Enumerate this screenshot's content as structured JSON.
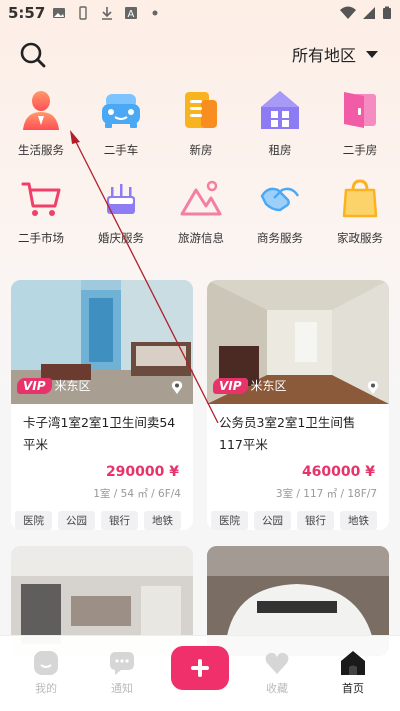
{
  "status_bar": {
    "time": "5:57"
  },
  "header": {
    "region_label": "所有地区",
    "icons": {
      "search": "search-icon",
      "dropdown": "caret-down-icon"
    }
  },
  "categories": [
    {
      "label": "生活服务",
      "icon": "person-service-icon",
      "color": "#ff6a55"
    },
    {
      "label": "二手车",
      "icon": "car-icon",
      "color": "#4aa8f5"
    },
    {
      "label": "新房",
      "icon": "building-icon",
      "color": "#f9a824"
    },
    {
      "label": "租房",
      "icon": "house-icon",
      "color": "#8c7bf2"
    },
    {
      "label": "二手房",
      "icon": "door-icon",
      "color": "#f25ba5"
    },
    {
      "label": "二手市场",
      "icon": "cart-icon",
      "color": "#f0406a"
    },
    {
      "label": "婚庆服务",
      "icon": "cake-icon",
      "color": "#8d7cf2"
    },
    {
      "label": "旅游信息",
      "icon": "mountain-icon",
      "color": "#f37fa3"
    },
    {
      "label": "商务服务",
      "icon": "handshake-icon",
      "color": "#4aa8f5"
    },
    {
      "label": "家政服务",
      "icon": "bag-icon",
      "color": "#f9b320"
    }
  ],
  "listings": [
    {
      "badge": "VIP",
      "district": "米东区",
      "title": "卡子湾1室2室1卫生间卖54平米",
      "price": "290000 ¥",
      "meta": "1室 / 54 ㎡ / 6F/4",
      "tags": [
        "",
        "医院",
        "公园",
        "银行",
        "地铁"
      ]
    },
    {
      "badge": "VIP",
      "district": "米东区",
      "title": "公务员3室2室1卫生间售117平米",
      "price": "460000 ¥",
      "meta": "3室 / 117 ㎡ / 18F/7",
      "tags": [
        "",
        "医院",
        "公园",
        "银行",
        "地铁"
      ]
    }
  ],
  "tabbar": {
    "tabs": [
      {
        "label": "我的",
        "icon": "profile-icon"
      },
      {
        "label": "通知",
        "icon": "message-icon"
      },
      {
        "label": "",
        "icon": "plus-icon"
      },
      {
        "label": "收藏",
        "icon": "heart-icon"
      },
      {
        "label": "首页",
        "icon": "home-icon"
      }
    ]
  },
  "colors": {
    "accent": "#e8336a",
    "plus_button": "#f0306a"
  }
}
